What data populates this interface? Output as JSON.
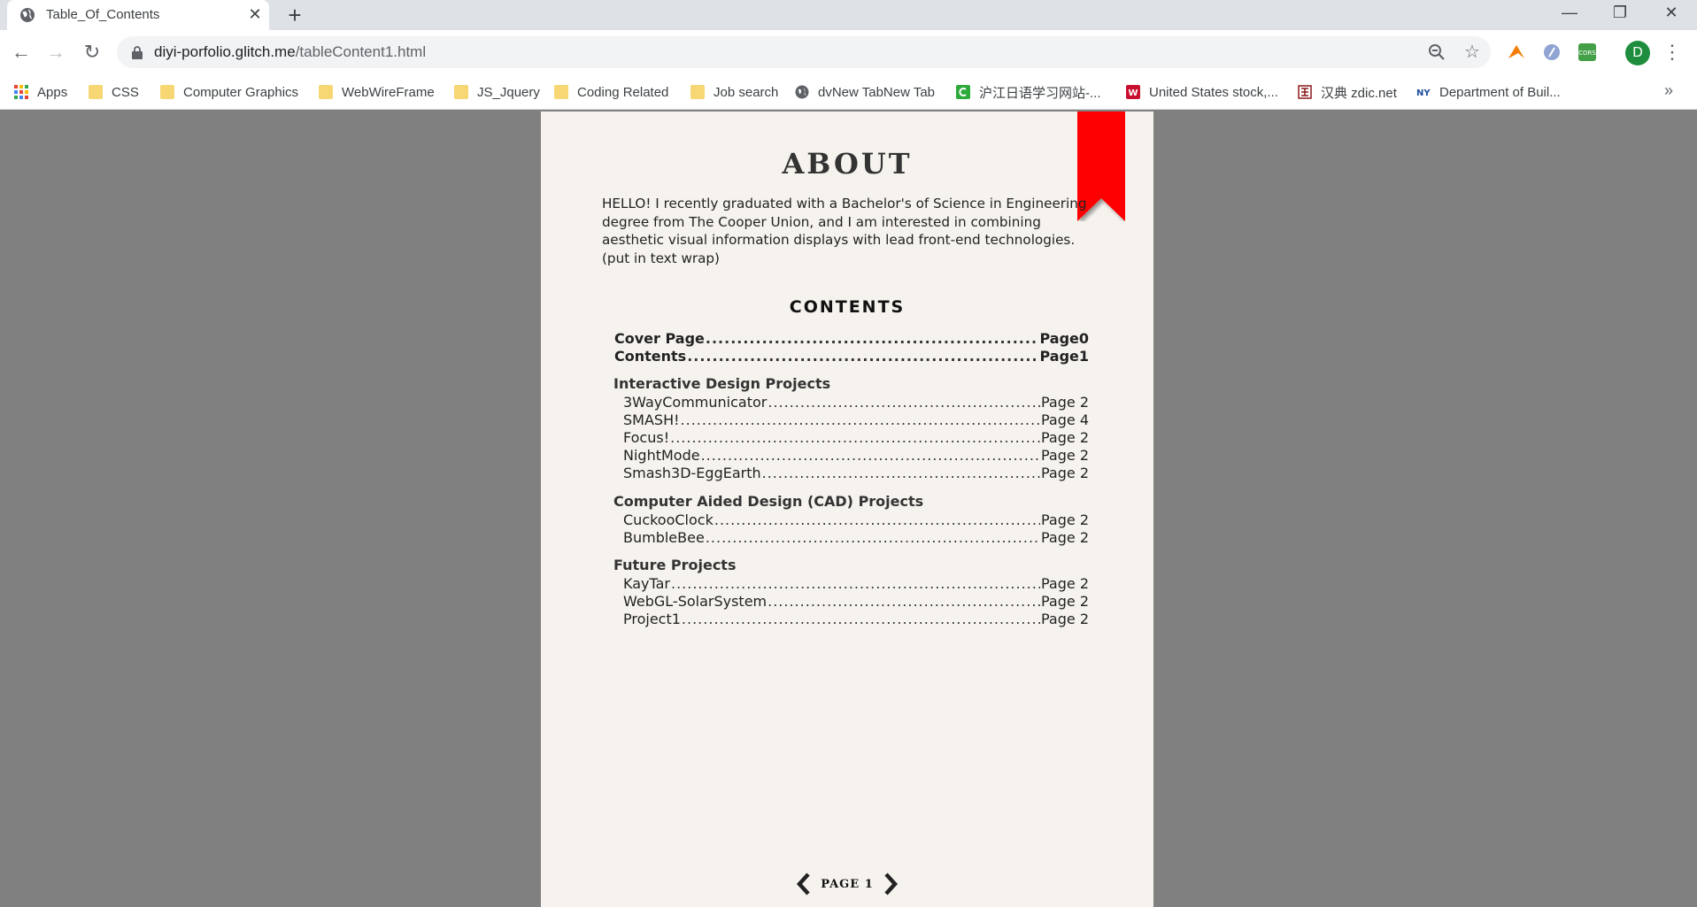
{
  "browser": {
    "tab_title": "Table_Of_Contents",
    "url_host": "diyi-porfolio.glitch.me",
    "url_path": "/tableContent1.html",
    "avatar_letter": "D"
  },
  "bookmarks": [
    {
      "label": "Apps",
      "icon": "apps-grid-icon"
    },
    {
      "label": "CSS",
      "icon": "folder-icon"
    },
    {
      "label": "Computer Graphics",
      "icon": "folder-icon"
    },
    {
      "label": "WebWireFrame",
      "icon": "folder-icon"
    },
    {
      "label": "JS_Jquery",
      "icon": "folder-icon"
    },
    {
      "label": "Coding Related",
      "icon": "folder-icon"
    },
    {
      "label": "Job search",
      "icon": "folder-icon"
    },
    {
      "label": "dvNew TabNew Tab",
      "icon": "globe-icon"
    },
    {
      "label": "沪江日语学习网站-...",
      "icon": "hujiang-icon"
    },
    {
      "label": "United States stock,...",
      "icon": "wsj-icon"
    },
    {
      "label": "汉典 zdic.net",
      "icon": "zdic-icon"
    },
    {
      "label": "Department of Buil...",
      "icon": "nyc-icon"
    }
  ],
  "document": {
    "about_title": "ABOUT",
    "about_text": "HELLO! I recently graduated with a Bachelor's of Science in Engineering degree from The Cooper Union, and I am interested in combining aesthetic visual information displays with lead front-end technologies. (put in text wrap)",
    "contents_title": "CONTENTS",
    "top_entries": [
      {
        "name": "Cover Page",
        "page": "Page0"
      },
      {
        "name": "Contents",
        "page": "Page1"
      }
    ],
    "sections": [
      {
        "title": "Interactive Design Projects",
        "entries": [
          {
            "name": "3WayCommunicator",
            "page": "Page 2"
          },
          {
            "name": "SMASH!",
            "page": "Page 4"
          },
          {
            "name": "Focus!",
            "page": "Page 2"
          },
          {
            "name": "NightMode",
            "page": "Page 2"
          },
          {
            "name": "Smash3D-EggEarth",
            "page": "Page 2"
          }
        ]
      },
      {
        "title": "Computer Aided Design (CAD) Projects",
        "entries": [
          {
            "name": "CuckooClock",
            "page": "Page 2"
          },
          {
            "name": "BumbleBee",
            "page": "Page 2"
          }
        ]
      },
      {
        "title": "Future Projects",
        "entries": [
          {
            "name": "KayTar",
            "page": "Page 2"
          },
          {
            "name": "WebGL-SolarSystem",
            "page": "Page 2"
          },
          {
            "name": "Project1",
            "page": "Page 2"
          }
        ]
      }
    ],
    "pager_label": "PAGE 1"
  },
  "colors": {
    "ribbon": "#ff0000",
    "page_bg": "#f6f3ee",
    "viewer_bg": "#808080"
  }
}
